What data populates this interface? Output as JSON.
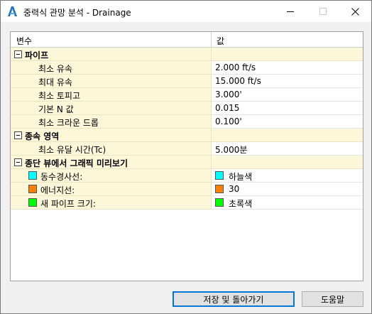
{
  "window": {
    "title": "중력식 관망 분석 - Drainage",
    "icon": "civil3d-a-icon",
    "controls": [
      "minimize-icon",
      "maximize-icon",
      "close-icon"
    ]
  },
  "grid": {
    "columns": {
      "name": "변수",
      "value": "값"
    },
    "categories": [
      {
        "label": "파이프",
        "properties": [
          {
            "label": "최소 유속",
            "value": "2.000 ft/s"
          },
          {
            "label": "최대 유속",
            "value": "15.000 ft/s"
          },
          {
            "label": "최소 토피고",
            "value": "3.000'"
          },
          {
            "label": "기본 N 값",
            "value": "0.015"
          },
          {
            "label": "최소 크라운 드롭",
            "value": "0.100'"
          }
        ]
      },
      {
        "label": "종속 영역",
        "properties": [
          {
            "label": "최소 유달 시간(Tc)",
            "value": "5.000분"
          }
        ]
      },
      {
        "label": "종단 뷰에서 그래픽 미리보기",
        "properties": [
          {
            "label": "동수경사선:",
            "value": "하늘색",
            "color": "#00ffff"
          },
          {
            "label": "에너지선:",
            "value": "30",
            "color": "#ff7f00"
          },
          {
            "label": "새 파이프 크기:",
            "value": "초록색",
            "color": "#00ff00"
          }
        ]
      }
    ]
  },
  "buttons": {
    "save_return": "저장 및 돌아가기",
    "help": "도움말"
  },
  "colors": {
    "category_bg": "#fdf7d9",
    "title_icon": "#1e73be",
    "default_button_border": "#0078d7"
  }
}
